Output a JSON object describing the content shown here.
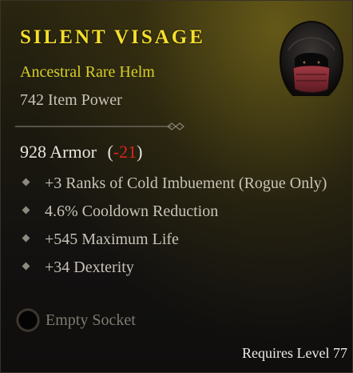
{
  "tooltip": {
    "item_name": "SILENT VISAGE",
    "item_type": "Ancestral Rare Helm",
    "item_power": "742 Item Power",
    "armor": {
      "value": "928 Armor",
      "open_paren": "(",
      "delta": "-21",
      "close_paren": ")"
    },
    "affixes": [
      {
        "text": "+3 Ranks of Cold Imbuement (Rogue Only)"
      },
      {
        "text": "4.6% Cooldown Reduction"
      },
      {
        "text": "+545 Maximum Life"
      },
      {
        "text": "+34 Dexterity"
      }
    ],
    "socket": {
      "label": "Empty Socket",
      "icon": "empty-socket-icon"
    },
    "requirement": "Requires Level 77",
    "item_icon": "hooded-helm-icon"
  },
  "colors": {
    "name": "#f4e02a",
    "rarity": "#d6cf2a",
    "delta_negative": "#d8261c",
    "stat_text": "#c9c4b8",
    "muted": "#7f7a70"
  }
}
